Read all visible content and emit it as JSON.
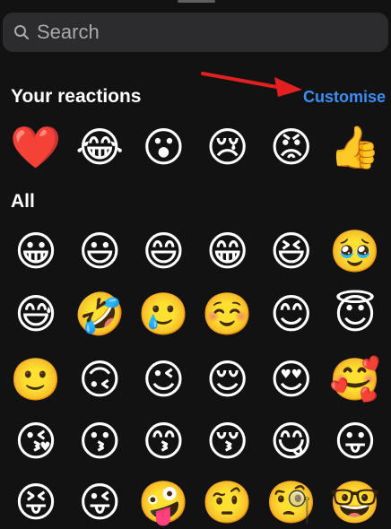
{
  "search": {
    "placeholder": "Search",
    "icon": "search-icon"
  },
  "reactions": {
    "title": "Your reactions",
    "customise_label": "Customise",
    "items": [
      "❤️",
      "😂",
      "😮",
      "😢",
      "😡",
      "👍"
    ]
  },
  "all": {
    "title": "All",
    "rows": [
      [
        "😀",
        "😃",
        "😄",
        "😁",
        "😆",
        "🥹"
      ],
      [
        "😅",
        "🤣",
        "🥲",
        "☺️",
        "😊",
        "😇"
      ],
      [
        "🙂",
        "🙃",
        "😉",
        "😌",
        "😍",
        "🥰"
      ],
      [
        "😘",
        "😗",
        "😙",
        "😚",
        "😋",
        "😛"
      ],
      [
        "😝",
        "😜",
        "🤪",
        "🤨",
        "🧐",
        "🤓"
      ]
    ]
  },
  "colors": {
    "accent": "#3a8ef6",
    "annotation_arrow": "#e32020",
    "background": "#121212",
    "search_bg": "#2c2c2e"
  }
}
